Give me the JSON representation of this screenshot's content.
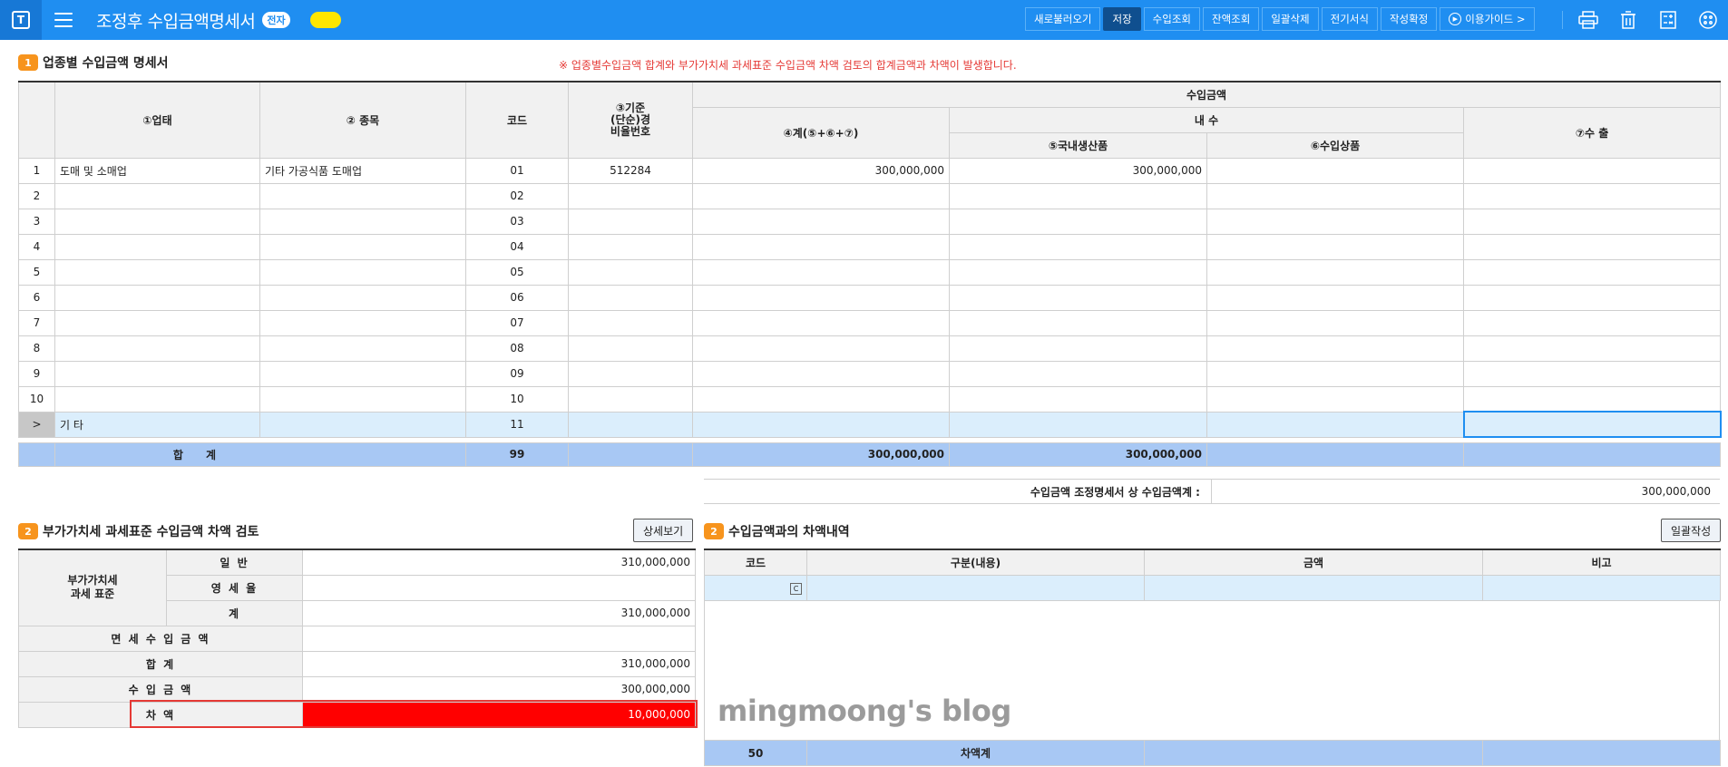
{
  "topbar": {
    "logo": "T",
    "title": "조정후 수입금액명세서",
    "badge": "전자",
    "buttons": [
      "새로불러오기",
      "저장",
      "수입조회",
      "잔액조회",
      "일괄삭제",
      "전기서식",
      "작성확정",
      "이용가이드 >"
    ]
  },
  "section1": {
    "num": "1",
    "title": "업종별 수입금액 명세서",
    "warning": "※ 업종별수입금액 합계와 부가가치세 과세표준 수입금액 차액 검토의 합계금액과 차액이 발생합니다.",
    "headers": {
      "col1": "①업태",
      "col2": "② 종목",
      "col3": "코드",
      "col4": "③기준\n(단순)경\n비율번호",
      "income": "수입금액",
      "domestic": "내 수",
      "total": "④계(⑤+⑥+⑦)",
      "local": "⑤국내생산품",
      "import": "⑥수입상품",
      "export": "⑦수 출"
    },
    "rows": [
      {
        "no": "1",
        "type": "도매 및 소매업",
        "item": "기타 가공식품 도매업",
        "code": "01",
        "rate": "512284",
        "total": "300,000,000",
        "local": "300,000,000",
        "import": "",
        "export": ""
      },
      {
        "no": "2",
        "type": "",
        "item": "",
        "code": "02",
        "rate": "",
        "total": "",
        "local": "",
        "import": "",
        "export": ""
      },
      {
        "no": "3",
        "type": "",
        "item": "",
        "code": "03",
        "rate": "",
        "total": "",
        "local": "",
        "import": "",
        "export": ""
      },
      {
        "no": "4",
        "type": "",
        "item": "",
        "code": "04",
        "rate": "",
        "total": "",
        "local": "",
        "import": "",
        "export": ""
      },
      {
        "no": "5",
        "type": "",
        "item": "",
        "code": "05",
        "rate": "",
        "total": "",
        "local": "",
        "import": "",
        "export": ""
      },
      {
        "no": "6",
        "type": "",
        "item": "",
        "code": "06",
        "rate": "",
        "total": "",
        "local": "",
        "import": "",
        "export": ""
      },
      {
        "no": "7",
        "type": "",
        "item": "",
        "code": "07",
        "rate": "",
        "total": "",
        "local": "",
        "import": "",
        "export": ""
      },
      {
        "no": "8",
        "type": "",
        "item": "",
        "code": "08",
        "rate": "",
        "total": "",
        "local": "",
        "import": "",
        "export": ""
      },
      {
        "no": "9",
        "type": "",
        "item": "",
        "code": "09",
        "rate": "",
        "total": "",
        "local": "",
        "import": "",
        "export": ""
      },
      {
        "no": "10",
        "type": "",
        "item": "",
        "code": "10",
        "rate": "",
        "total": "",
        "local": "",
        "import": "",
        "export": ""
      }
    ],
    "etc_row": {
      "marker": ">",
      "type": "기  타",
      "code": "11"
    },
    "total_row": {
      "label": "합      계",
      "code": "99",
      "total": "300,000,000",
      "local": "300,000,000"
    }
  },
  "summary_line": {
    "label": "수입금액 조정명세서 상 수입금액계 :",
    "value": "300,000,000"
  },
  "section2": {
    "num": "2",
    "title": "부가가치세 과세표준 수입금액 차액 검토",
    "detail_button": "상세보기",
    "vat_label": "부가가치세\n과세 표준",
    "general_label": "일  반",
    "general_value": "310,000,000",
    "zero_label": "영 세 율",
    "zero_value": "",
    "sum_label": "계",
    "sum_value": "310,000,000",
    "exempt_label": "면 세 수 입 금 액",
    "exempt_value": "",
    "total_label": "합 계",
    "total_value": "310,000,000",
    "income_label": "수 입 금 액",
    "income_value": "300,000,000",
    "diff_label": "차  액",
    "diff_value": "10,000,000"
  },
  "section3": {
    "num": "2",
    "title": "수입금액과의 차액내역",
    "batch_button": "일괄작성",
    "headers": [
      "코드",
      "구분(내용)",
      "금액",
      "비고"
    ],
    "cal_glyph": "C",
    "total_code": "50",
    "total_label": "차액계"
  },
  "watermark": "mingmoong's blog",
  "colors": {
    "topbar": "#1f8ef1",
    "accent_orange": "#f7941d",
    "total_row": "#a8c8f4",
    "selected_row": "#dbeefc",
    "diff_red": "#ff0000",
    "warning": "#e53935"
  }
}
